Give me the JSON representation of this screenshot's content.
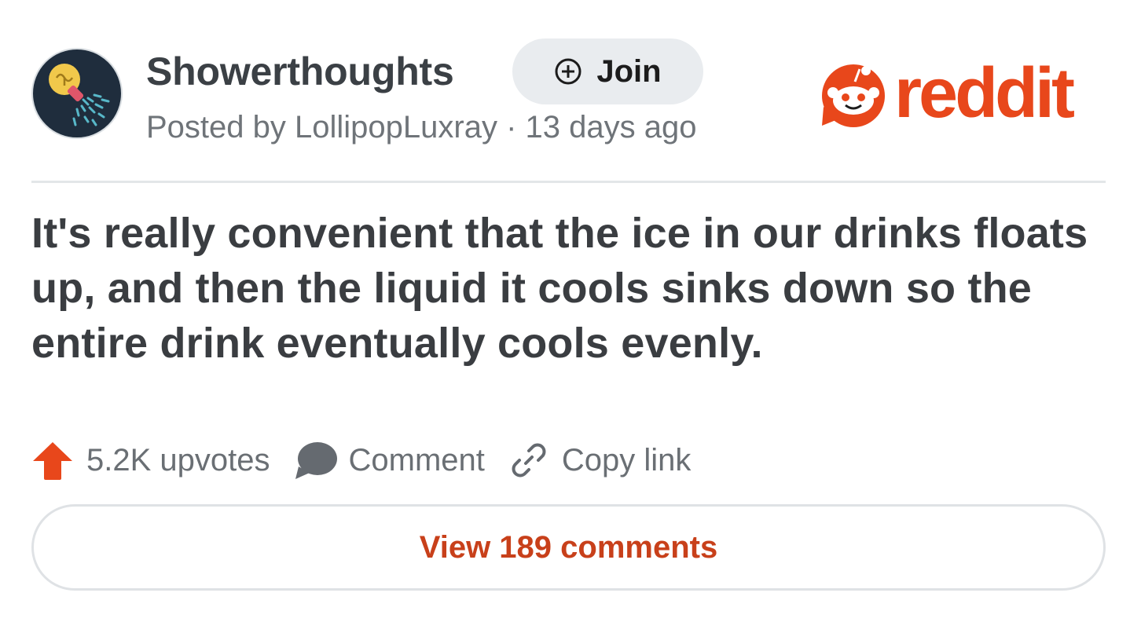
{
  "post": {
    "subreddit": "Showerthoughts",
    "join_label": "Join",
    "meta": "Posted by LollipopLuxray · 13 days ago",
    "brand_word": "reddit",
    "title": "It's really convenient that the ice in our drinks floats up, and then the liquid it cools sinks down so the entire drink eventually cools evenly.",
    "upvotes": "5.2K upvotes",
    "comment_label": "Comment",
    "copy_link_label": "Copy link",
    "view_comments_label": "View 189 comments"
  },
  "icons": {
    "avatar": "lightbulb-shower-icon",
    "join": "plus-circle-icon",
    "logo": "reddit-snoo-icon",
    "upvote": "upvote-arrow-icon",
    "comment": "comment-bubble-icon",
    "copy_link": "link-chain-icon"
  },
  "colors": {
    "brand_orange": "#e8471b",
    "upvote_orange": "#e8471b",
    "comments_link": "#c8401a",
    "title_text": "#3a3d41",
    "meta_text": "#6f7479",
    "join_bg": "#e9ecef"
  }
}
